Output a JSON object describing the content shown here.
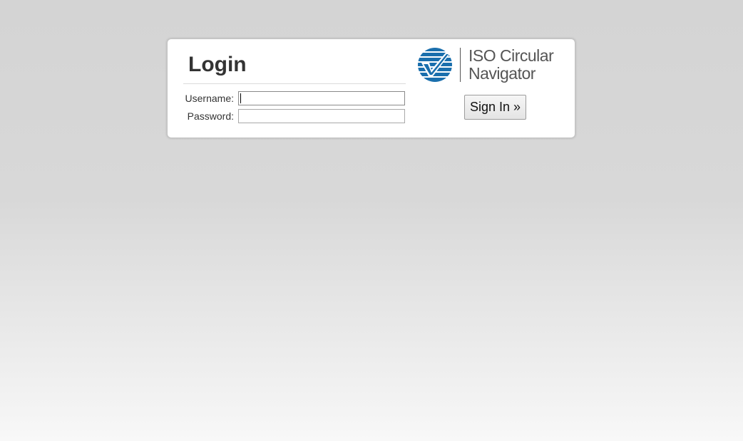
{
  "login": {
    "title": "Login",
    "username_label": "Username:",
    "username_value": "",
    "password_label": "Password:",
    "password_value": "",
    "signin_label": "Sign In »"
  },
  "logo": {
    "line1": "ISO Circular",
    "line2": "Navigator",
    "icon": "checkmark-globe-icon",
    "color": "#1a6fad"
  },
  "colors": {
    "background_top": "#d4d4d4",
    "background_bottom": "#f8f8f8",
    "panel": "#ffffff",
    "brand_blue": "#1a6fad"
  }
}
